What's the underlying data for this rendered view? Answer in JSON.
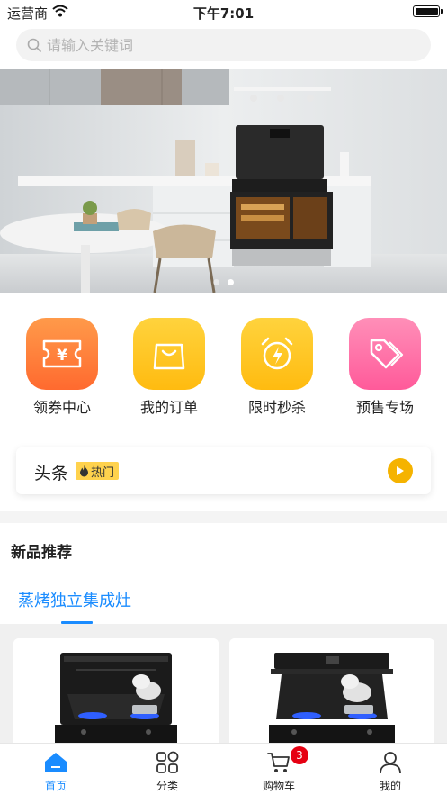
{
  "status_bar": {
    "carrier": "运营商",
    "time": "下午7:01"
  },
  "search": {
    "placeholder": "请输入关键词",
    "value": ""
  },
  "banner": {
    "slide_count": 2,
    "active_slide": 2
  },
  "quick_links": [
    {
      "label": "领券中心",
      "icon": "coupon-ticket-icon",
      "color": "#ff7a3a"
    },
    {
      "label": "我的订单",
      "icon": "shopping-bag-icon",
      "color": "#ffc21a"
    },
    {
      "label": "限时秒杀",
      "icon": "alarm-clock-icon",
      "color": "#ffc21a"
    },
    {
      "label": "预售专场",
      "icon": "price-tag-icon",
      "color": "#ff5a9a"
    }
  ],
  "headline": {
    "title": "头条",
    "badge": "热门",
    "badge_icon": "flame-icon",
    "action_icon": "play-icon"
  },
  "new_products": {
    "title": "新品推荐",
    "active_tab": "蒸烤独立集成灶"
  },
  "tab_bar": {
    "items": [
      {
        "label": "首页",
        "icon": "home-icon",
        "active": true
      },
      {
        "label": "分类",
        "icon": "category-grid-icon",
        "active": false
      },
      {
        "label": "购物车",
        "icon": "cart-icon",
        "active": false,
        "badge": "3"
      },
      {
        "label": "我的",
        "icon": "user-icon",
        "active": false
      }
    ]
  },
  "colors": {
    "accent": "#1a8cff",
    "badge_red": "#e60012",
    "hot_yellow": "#ffd24d"
  }
}
